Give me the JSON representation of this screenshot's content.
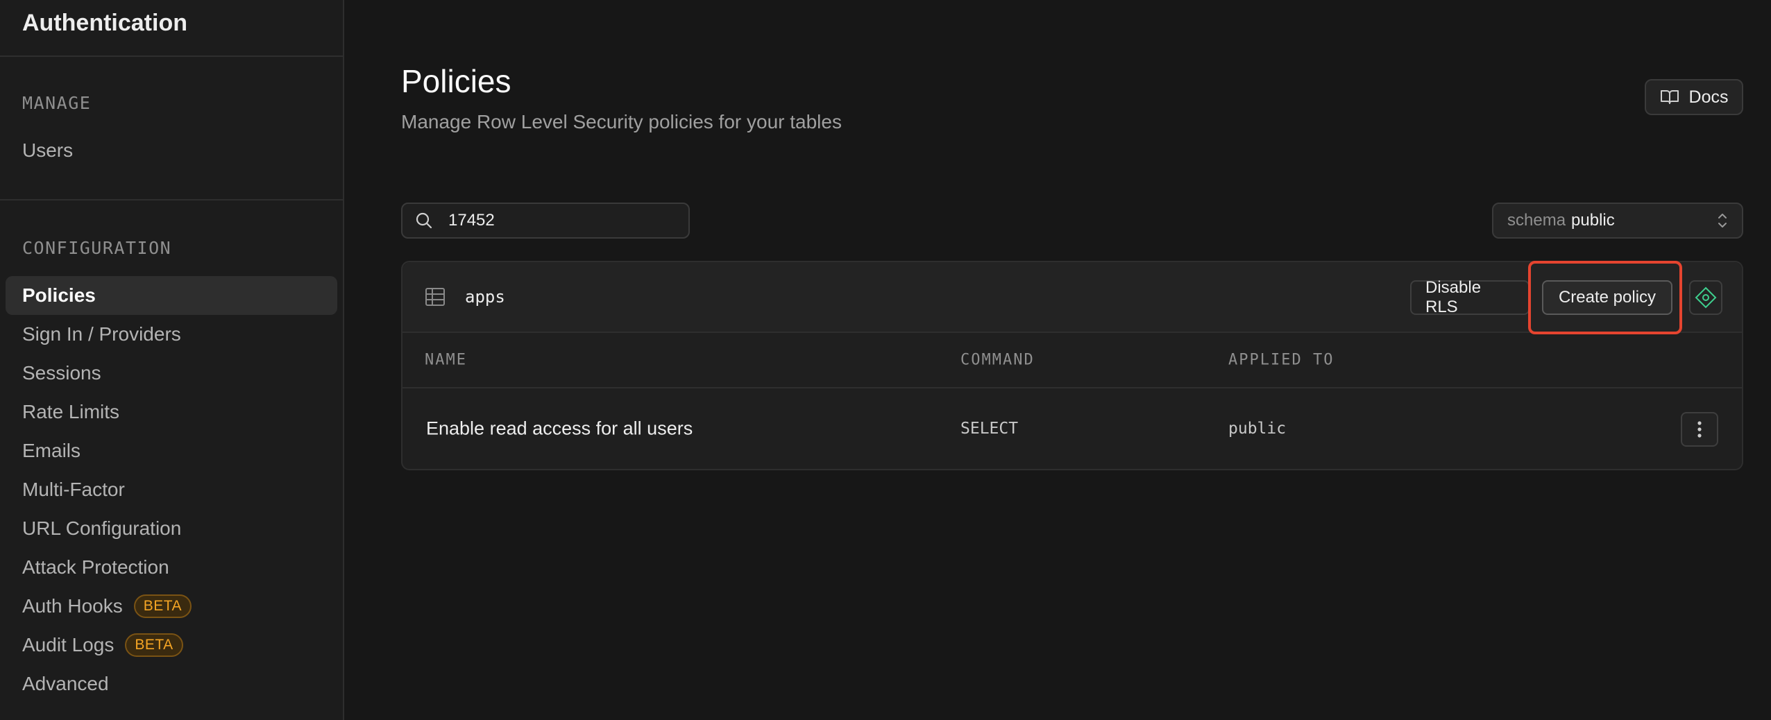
{
  "sidebar": {
    "title": "Authentication",
    "manage": {
      "heading": "MANAGE",
      "items": [
        {
          "label": "Users"
        }
      ]
    },
    "configuration": {
      "heading": "CONFIGURATION",
      "items": [
        {
          "label": "Policies",
          "active": true
        },
        {
          "label": "Sign In / Providers"
        },
        {
          "label": "Sessions"
        },
        {
          "label": "Rate Limits"
        },
        {
          "label": "Emails"
        },
        {
          "label": "Multi-Factor"
        },
        {
          "label": "URL Configuration"
        },
        {
          "label": "Attack Protection"
        },
        {
          "label": "Auth Hooks",
          "badge": "BETA"
        },
        {
          "label": "Audit Logs",
          "badge": "BETA"
        },
        {
          "label": "Advanced"
        }
      ]
    }
  },
  "header": {
    "title": "Policies",
    "subtitle": "Manage Row Level Security policies for your tables",
    "docs_label": "Docs"
  },
  "search": {
    "value": "17452"
  },
  "schema": {
    "label": "schema",
    "value": "public"
  },
  "table": {
    "name": "apps",
    "disable_rls_label": "Disable RLS",
    "create_policy_label": "Create policy",
    "columns": [
      "NAME",
      "COMMAND",
      "APPLIED TO"
    ],
    "rows": [
      {
        "name": "Enable read access for all users",
        "command": "SELECT",
        "applied_to": "public"
      }
    ]
  },
  "colors": {
    "background": "#171717",
    "sidebar": "#1c1c1c",
    "badge": "#f5a524",
    "highlight": "#e5442f",
    "ai_accent": "#3ecf8e"
  }
}
